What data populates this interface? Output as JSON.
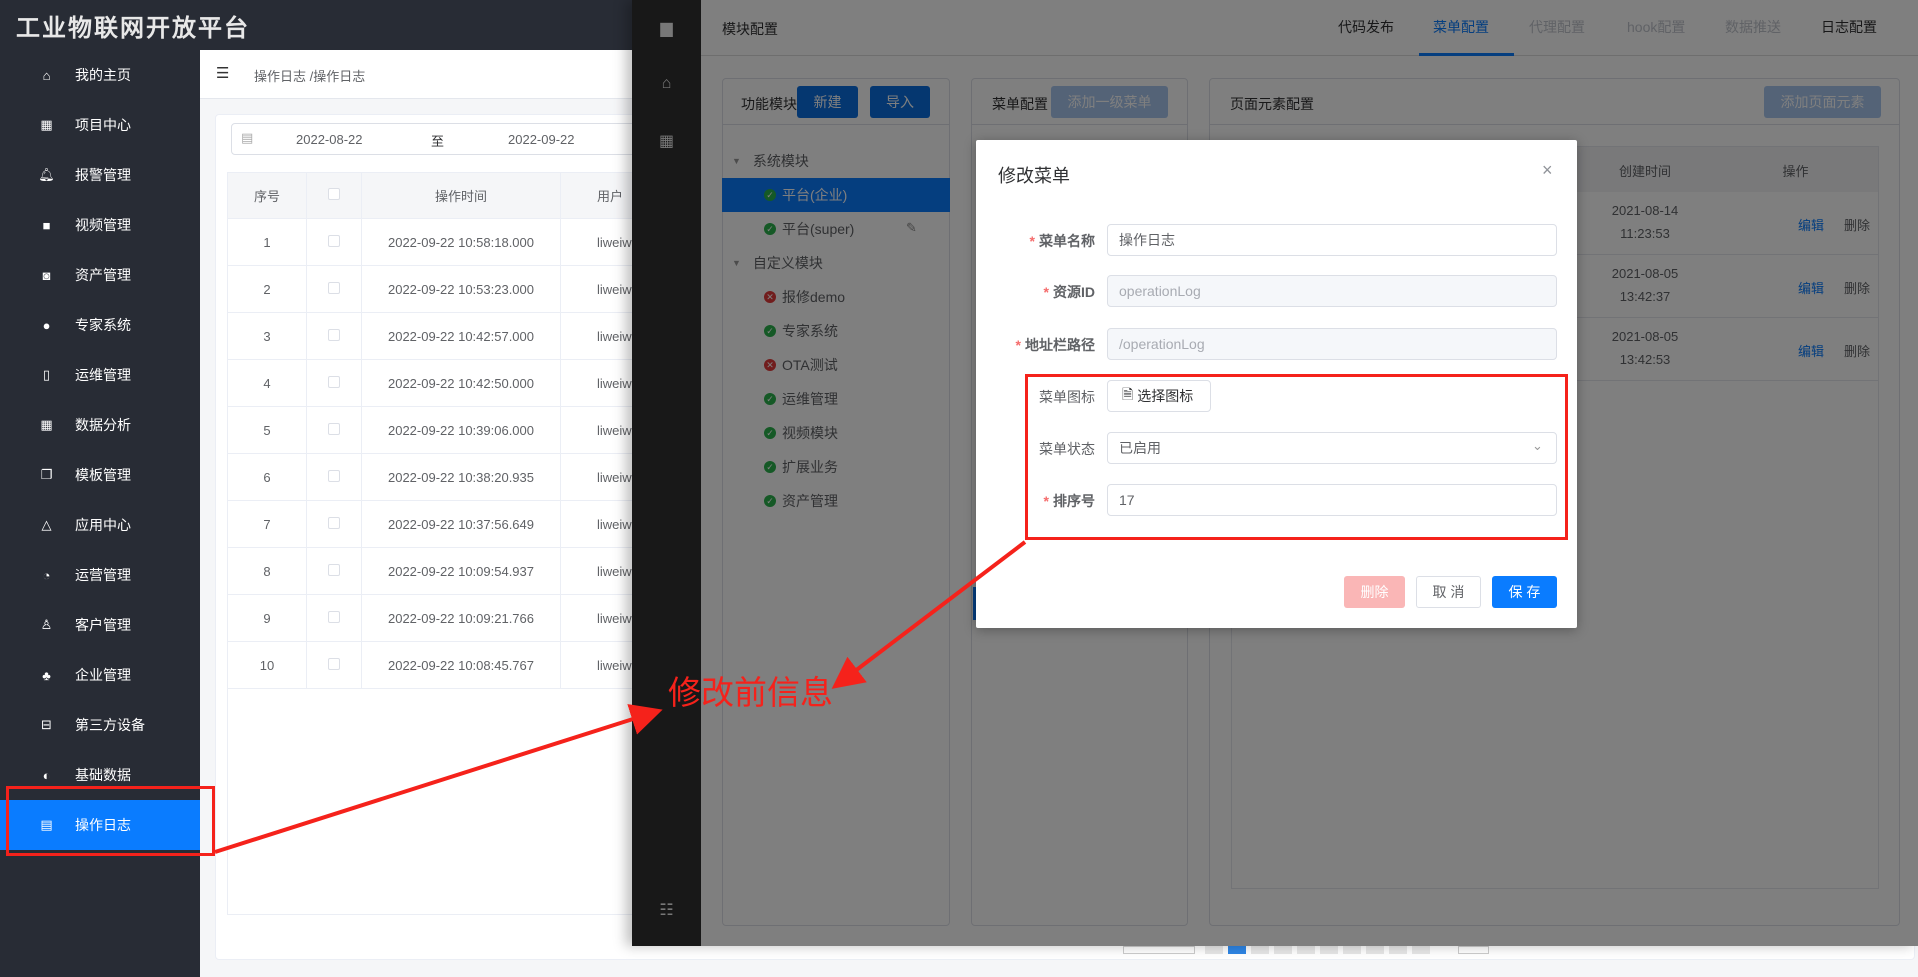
{
  "app": {
    "title": "工业物联网开放平台"
  },
  "sidebar": {
    "items": [
      {
        "label": "我的主页",
        "icon": "home-icon",
        "glyph": "⌂"
      },
      {
        "label": "项目中心",
        "icon": "grid-icon",
        "glyph": "▦"
      },
      {
        "label": "报警管理",
        "icon": "bell-icon",
        "glyph": "🔔︎"
      },
      {
        "label": "视频管理",
        "icon": "video-icon",
        "glyph": "■"
      },
      {
        "label": "资产管理",
        "icon": "camera-icon",
        "glyph": "◙"
      },
      {
        "label": "专家系统",
        "icon": "user-icon",
        "glyph": "●"
      },
      {
        "label": "运维管理",
        "icon": "building-icon",
        "glyph": "▯"
      },
      {
        "label": "数据分析",
        "icon": "grid-icon",
        "glyph": "▦"
      },
      {
        "label": "模板管理",
        "icon": "copy-icon",
        "glyph": "❐"
      },
      {
        "label": "应用中心",
        "icon": "bell-icon",
        "glyph": "△"
      },
      {
        "label": "运营管理",
        "icon": "pie-chart-icon",
        "glyph": "◔"
      },
      {
        "label": "客户管理",
        "icon": "user-outline-icon",
        "glyph": "♙"
      },
      {
        "label": "企业管理",
        "icon": "org-chart-icon",
        "glyph": "♣"
      },
      {
        "label": "第三方设备",
        "icon": "drive-icon",
        "glyph": "⊟"
      },
      {
        "label": "基础数据",
        "icon": "contrast-icon",
        "glyph": "◐"
      },
      {
        "label": "操作日志",
        "icon": "document-icon",
        "glyph": "▤",
        "active": true
      }
    ]
  },
  "breadcrumb": "操作日志 /操作日志",
  "date_range": {
    "start": "2022-08-22",
    "separator": "至",
    "end": "2022-09-22"
  },
  "log_table": {
    "headers": [
      "序号",
      "",
      "操作时间",
      "用户"
    ],
    "rows": [
      [
        "1",
        "2022-09-22 10:58:18.000",
        "liweiw"
      ],
      [
        "2",
        "2022-09-22 10:53:23.000",
        "liweiw"
      ],
      [
        "3",
        "2022-09-22 10:42:57.000",
        "liweiw"
      ],
      [
        "4",
        "2022-09-22 10:42:50.000",
        "liweiw"
      ],
      [
        "5",
        "2022-09-22 10:39:06.000",
        "liweiw"
      ],
      [
        "6",
        "2022-09-22 10:38:20.935",
        "liweiw"
      ],
      [
        "7",
        "2022-09-22 10:37:56.649",
        "liweiw"
      ],
      [
        "8",
        "2022-09-22 10:09:54.937",
        "liweiw"
      ],
      [
        "9",
        "2022-09-22 10:09:21.766",
        "liweiw"
      ],
      [
        "10",
        "2022-09-22 10:08:45.767",
        "liweiw"
      ]
    ]
  },
  "overlay": {
    "title": "模块配置",
    "tabs": [
      {
        "label": "代码发布"
      },
      {
        "label": "菜单配置",
        "active": true
      },
      {
        "label": "代理配置",
        "disabled": true
      },
      {
        "label": "hook配置",
        "disabled": true
      },
      {
        "label": "数据推送",
        "disabled": true
      },
      {
        "label": "日志配置"
      }
    ],
    "module_panel": {
      "title": "功能模块",
      "new": "新建",
      "import": "导入",
      "tree": [
        {
          "label": "系统模块",
          "group": true
        },
        {
          "label": "平台(企业)",
          "status": "ok",
          "selected": true
        },
        {
          "label": "平台(super)",
          "status": "ok"
        },
        {
          "label": "自定义模块",
          "group": true
        },
        {
          "label": "报修demo",
          "status": "error"
        },
        {
          "label": "专家系统",
          "status": "ok"
        },
        {
          "label": "OTA测试",
          "status": "error"
        },
        {
          "label": "运维管理",
          "status": "ok"
        },
        {
          "label": "视频模块",
          "status": "ok"
        },
        {
          "label": "扩展业务",
          "status": "ok"
        },
        {
          "label": "资产管理",
          "status": "ok"
        }
      ]
    },
    "menu_panel": {
      "title": "菜单配置",
      "add": "添加一级菜单"
    },
    "element_panel": {
      "title": "页面元素配置",
      "add": "添加页面元素",
      "headers": [
        "创建时间",
        "操作"
      ],
      "rows": [
        {
          "date": "2021-08-14",
          "time": "11:23:53",
          "edit": "编辑",
          "delete": "删除"
        },
        {
          "date": "2021-08-05",
          "time": "13:42:37",
          "edit": "编辑",
          "delete": "删除"
        },
        {
          "date": "2021-08-05",
          "time": "13:42:53",
          "edit": "编辑",
          "delete": "删除"
        }
      ]
    }
  },
  "modal": {
    "title": "修改菜单",
    "fields": [
      {
        "label": "菜单名称",
        "required": true,
        "value": "操作日志"
      },
      {
        "label": "资源ID",
        "required": true,
        "value": "operationLog",
        "disabled": true
      },
      {
        "label": "地址栏路径",
        "required": true,
        "value": "/operationLog",
        "disabled": true
      },
      {
        "label": "菜单图标",
        "button": "选择图标"
      },
      {
        "label": "菜单状态",
        "value": "已启用"
      },
      {
        "label": "排序号",
        "required": true,
        "value": "17"
      }
    ],
    "delete": "删除",
    "cancel": "取 消",
    "save": "保 存"
  },
  "annotation": {
    "text": "修改前信息",
    "color": "#f5221b"
  },
  "colors": {
    "primary": "#0a7cff",
    "sidebar": "#282c35",
    "annotation": "#f5221b"
  }
}
